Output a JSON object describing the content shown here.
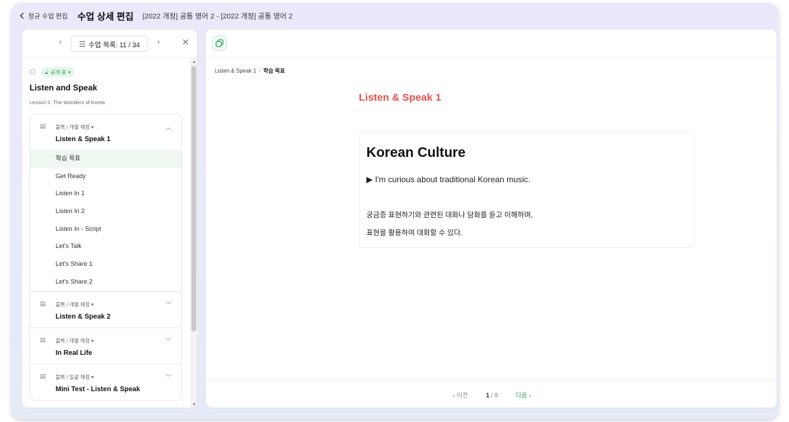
{
  "topbar": {
    "back_label": "정규 수업 편집",
    "title": "수업 상세 편집",
    "course": "[2022 개정] 공통 영어 2 - [2022 개정] 공통 영어 2"
  },
  "left_header": {
    "prev": "‹",
    "list_label": "수업 목록: 11 / 34",
    "next": "›",
    "close": "✕"
  },
  "lesson": {
    "status": "공개 중",
    "title": "Listen and Speak",
    "subtitle": "Lesson 2. The Wonders of Korea"
  },
  "blocks": [
    {
      "type": "블록 / 개별 채점",
      "name": "Listen & Speak 1",
      "expanded": true,
      "items": [
        "학습 목표",
        "Get Ready",
        "Listen In 1",
        "Listen In 2",
        "Listen In - Script",
        "Let's Talk",
        "Let's Share 1",
        "Let's Share 2"
      ]
    },
    {
      "type": "블록 / 개별 채점",
      "name": "Listen & Speak 2",
      "expanded": false
    },
    {
      "type": "블록 / 개별 채점",
      "name": "In Real Life",
      "expanded": false
    },
    {
      "type": "블록 / 일괄 채점",
      "name": "Mini Test - Listen & Speak",
      "expanded": false
    }
  ],
  "breadcrumb": {
    "parent": "Listen & Speak 1",
    "current": "학습 목표"
  },
  "content": {
    "page_title": "Listen & Speak 1",
    "heading": "Korean Culture",
    "line1": "▶ I'm curious about traditional Korean music.",
    "kor1": "궁금증 표현하기와 관련된 대화나 담화를 듣고 이해하며,",
    "kor2": "표현을 활용하여 대화할 수 있다."
  },
  "pager": {
    "prev": "‹ 이전",
    "current": "1",
    "total": "/ 8",
    "next": "다음 ›"
  },
  "colors": {
    "accent_green": "#2f9e5b",
    "title_red": "#e5504b",
    "active_bg": "#eef7f0"
  }
}
